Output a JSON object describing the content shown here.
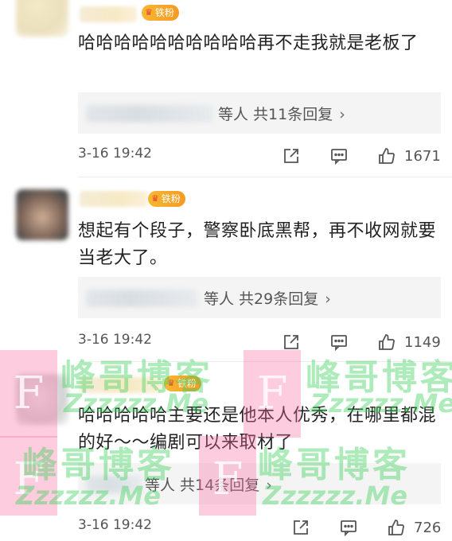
{
  "comments": [
    {
      "badge": "铁粉",
      "text": "哈哈哈哈哈哈哈哈哈哈再不走我就是老板了",
      "reply_text": "等人  共11条回复",
      "time": "3-16 19:42",
      "likes": "1671"
    },
    {
      "badge": "铁粉",
      "text": "想起有个段子，警察卧底黑帮，再不收网就要当老大了。",
      "reply_text": "等人  共29条回复",
      "time": "3-16 19:42",
      "likes": "1149"
    },
    {
      "badge": "铁粉",
      "text": "哈哈哈哈哈主要还是他本人优秀，在哪里都混的好～～编剧可以来取材了",
      "reply_text": "等人  共14条回复",
      "time": "3-16 19:42",
      "likes": "726"
    }
  ],
  "icons": {
    "share": "share-icon",
    "comment": "comment-icon",
    "like": "thumbs-up-icon",
    "chevron": "chevron-right-icon"
  },
  "watermark": {
    "cn": "峰哥博客",
    "en": "Zzzzzz.Me",
    "letter": "F"
  },
  "colors": {
    "badge": "#f5a623",
    "watermark": "#3cd25a",
    "reply_bg": "#f4f4f4"
  }
}
